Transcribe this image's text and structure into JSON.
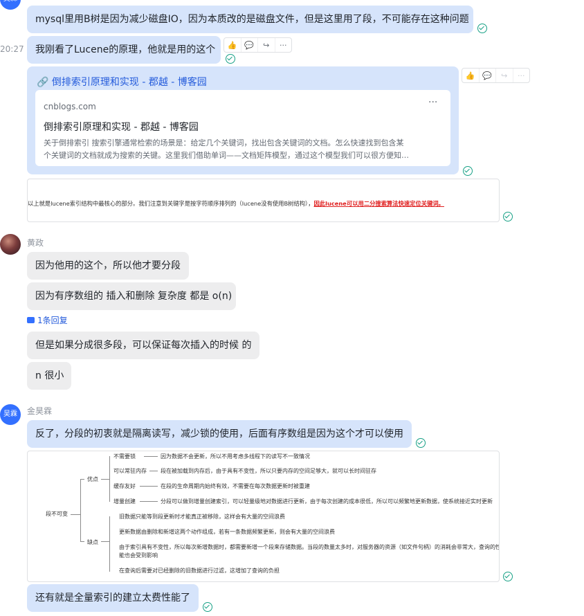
{
  "msg1": {
    "text": "mysql里用B树是因为减少磁盘IO，因为本质改的是磁盘文件，但是这里用了段，不可能存在这种问题"
  },
  "msg2": {
    "time": "20:27",
    "text": "我刚看了Lucene的原理，他就是用的这个"
  },
  "toolbar": {
    "like_icon": "👍",
    "comment_icon": "💬",
    "share_icon": "↪",
    "more_icon": "···"
  },
  "link_card": {
    "title": "倒排索引原理和实现 - 郡越 - 博客园",
    "domain": "cnblogs.com",
    "more": "···",
    "preview_title": "倒排索引原理和实现 - 郡越 - 博客园",
    "preview_desc_1": "关于倒排索引 搜索引擎通常检索的场景是：给定几个关键词，找出包含关键词的文档。怎么快速找到包含某",
    "preview_desc_2": "个关键词的文档就成为搜索的关键。这里我们借助单词——文档矩阵模型，通过这个模型我们可以很方便知…"
  },
  "screenshot1": {
    "text_normal": "以上就是lucene索引结构中最核心的部分。我们注意到关键字是按字符顺序排列的（lucene没有使用B树结构），",
    "text_red": "因此lucene可以用二分搜索算法快速定位关键词。"
  },
  "user2": {
    "name": "黄政"
  },
  "msg3": {
    "text": "因为他用的这个，所以他才要分段"
  },
  "msg4": {
    "text": "因为有序数组的 插入和删除 复杂度 都是 o(n)"
  },
  "reply": {
    "text": "1条回复"
  },
  "msg5": {
    "text": "但是如果分成很多段，可以保证每次插入的时候 的"
  },
  "msg6": {
    "text": "n 很小"
  },
  "user3": {
    "name": "金昊霖",
    "avatar_text": "吴霖"
  },
  "user1": {
    "avatar_text": "吴霖"
  },
  "msg7": {
    "text": "反了，分段的初衷就是隔离读写，减少锁的使用，后面有序数组是因为这个才可以使用"
  },
  "mindmap": {
    "root": "段不可变",
    "pros_label": "优点",
    "cons_label": "缺点",
    "pros": [
      {
        "title": "不需要锁",
        "desc": "因为数据不会更新，所以不用考虑多线程下的读写不一致情况"
      },
      {
        "title": "可以常驻内存",
        "desc": "段在被加载到内存后，由于具有不变性，所以只要内存的空间足够大，就可以长时间驻存"
      },
      {
        "title": "缓存友好",
        "desc": "在段的生命周期内始终有效，不需要在每次数据更新时被重建"
      },
      {
        "title": "增量创建",
        "desc": "分段可以做到增量创建索引，可以轻量级地对数据进行更新，由于每次创建的成本很低，所以可以频繁地更新数据，使系统接近实时更新"
      }
    ],
    "cons": [
      "旧数据只能等到段更新时才能真正被移除，这样会有大量的空间浪费",
      "更新数据由删除和新增这两个动作组成，若有一条数据频繁更新，则会有大量的空间浪费",
      "由于索引具有不变性，所以每次新增数据时，都需要新增一个段来存储数据。当段的数量太多时，对服务器的资源（如文件句柄）的消耗会非常大，查询的性",
      "能也会受到影响",
      "在查询后需要对已经删除的旧数据进行过滤，这增加了查询的负担"
    ]
  },
  "msg8": {
    "text": "还有就是全量索引的建立太费性能了"
  },
  "colors": {
    "blue_bubble": "#d6e4fb",
    "gray_bubble": "#ededee",
    "accent": "#3370ff",
    "read_check": "#16a085",
    "red_text": "#e02020"
  }
}
